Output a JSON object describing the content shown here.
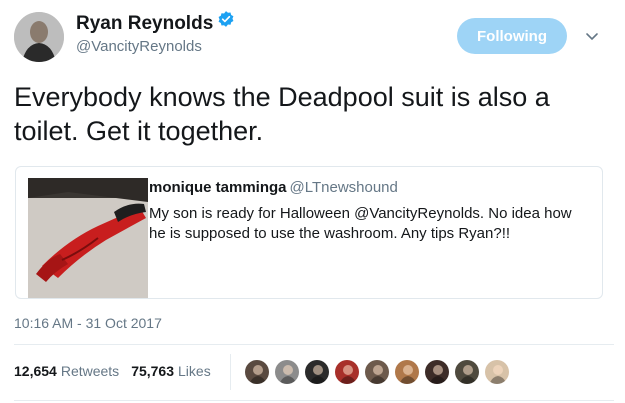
{
  "tweet": {
    "author_name": "Ryan Reynolds",
    "author_handle": "@VancityReynolds",
    "follow_label": "Following",
    "text": "Everybody knows the Deadpool suit is also a toilet. Get it together.",
    "timestamp": "10:16 AM - 31 Oct 2017",
    "retweets_count": "12,654",
    "retweets_label": "Retweets",
    "likes_count": "75,763",
    "likes_label": "Likes"
  },
  "quoted": {
    "author_name": "monique tamminga",
    "author_handle": "@LTnewshound",
    "text": "My son is ready for Halloween @VancityReynolds. No idea how he is supposed to use the washroom. Any tips Ryan?!!"
  },
  "colors": {
    "follow_button": "#9ed4f6",
    "verified_badge": "#1da1f2",
    "muted_text": "#657786"
  },
  "likers": [
    {
      "icon": "avatar",
      "color": "#5a4a40"
    },
    {
      "icon": "avatar",
      "color": "#8c8c8c"
    },
    {
      "icon": "avatar",
      "color": "#2b2b2b"
    },
    {
      "icon": "avatar",
      "color": "#a8302a"
    },
    {
      "icon": "avatar",
      "color": "#6d5a4c"
    },
    {
      "icon": "avatar",
      "color": "#b0784a"
    },
    {
      "icon": "avatar",
      "color": "#3d2c28"
    },
    {
      "icon": "avatar",
      "color": "#4f4a3e"
    },
    {
      "icon": "avatar",
      "color": "#d7c2a8"
    }
  ]
}
